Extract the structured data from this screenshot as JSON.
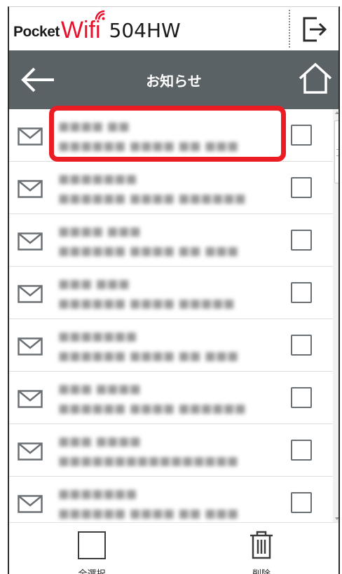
{
  "header": {
    "brand_pocket": "Pocket",
    "brand_wifi": "Wifi",
    "model": "504HW",
    "logout_icon": "logout-icon"
  },
  "nav": {
    "title": "お知らせ",
    "back_icon": "arrow-left-icon",
    "home_icon": "home-icon"
  },
  "messages": [
    {
      "icon": "mail-icon",
      "title": "■■■■ ■■",
      "body": "■■■■■■ ■■■■ ■■ ■■■",
      "checked": false,
      "highlighted": true
    },
    {
      "icon": "mail-icon",
      "title": "■■■■■■■",
      "body": "■■■■■■ ■■■■ ■■■■■■",
      "checked": false,
      "highlighted": false
    },
    {
      "icon": "mail-icon",
      "title": "■■■■ ■■■",
      "body": "■■■■■■ ■■■■ ■■ ■■■",
      "checked": false,
      "highlighted": false
    },
    {
      "icon": "mail-icon",
      "title": "■■■ ■■■",
      "body": "■■■■■■ ■■■■ ■■■■■",
      "checked": false,
      "highlighted": false
    },
    {
      "icon": "mail-icon",
      "title": "■■■■■■■",
      "body": "■■■■■■ ■■■■ ■■ ■■■",
      "checked": false,
      "highlighted": false
    },
    {
      "icon": "mail-icon",
      "title": "■■■ ■■■■",
      "body": "■■■■■■ ■■■■ ■■■■■■",
      "checked": false,
      "highlighted": false
    },
    {
      "icon": "mail-icon",
      "title": "■■■ ■■■■",
      "body": "■■■■■■■■■■■■■■■■",
      "checked": false,
      "highlighted": false
    },
    {
      "icon": "mail-icon",
      "title": "■■■■■■■",
      "body": "■■■■■■ ■■■■ ■■ ■■■",
      "checked": false,
      "highlighted": false
    }
  ],
  "footer": {
    "select_all_label": "全選択",
    "delete_label": "削除",
    "delete_icon": "trash-icon"
  },
  "colors": {
    "navbar": "#5b6266",
    "brand_red": "#e8102a",
    "highlight_red": "#ec1c24",
    "icon_gray": "#6a6f73"
  }
}
